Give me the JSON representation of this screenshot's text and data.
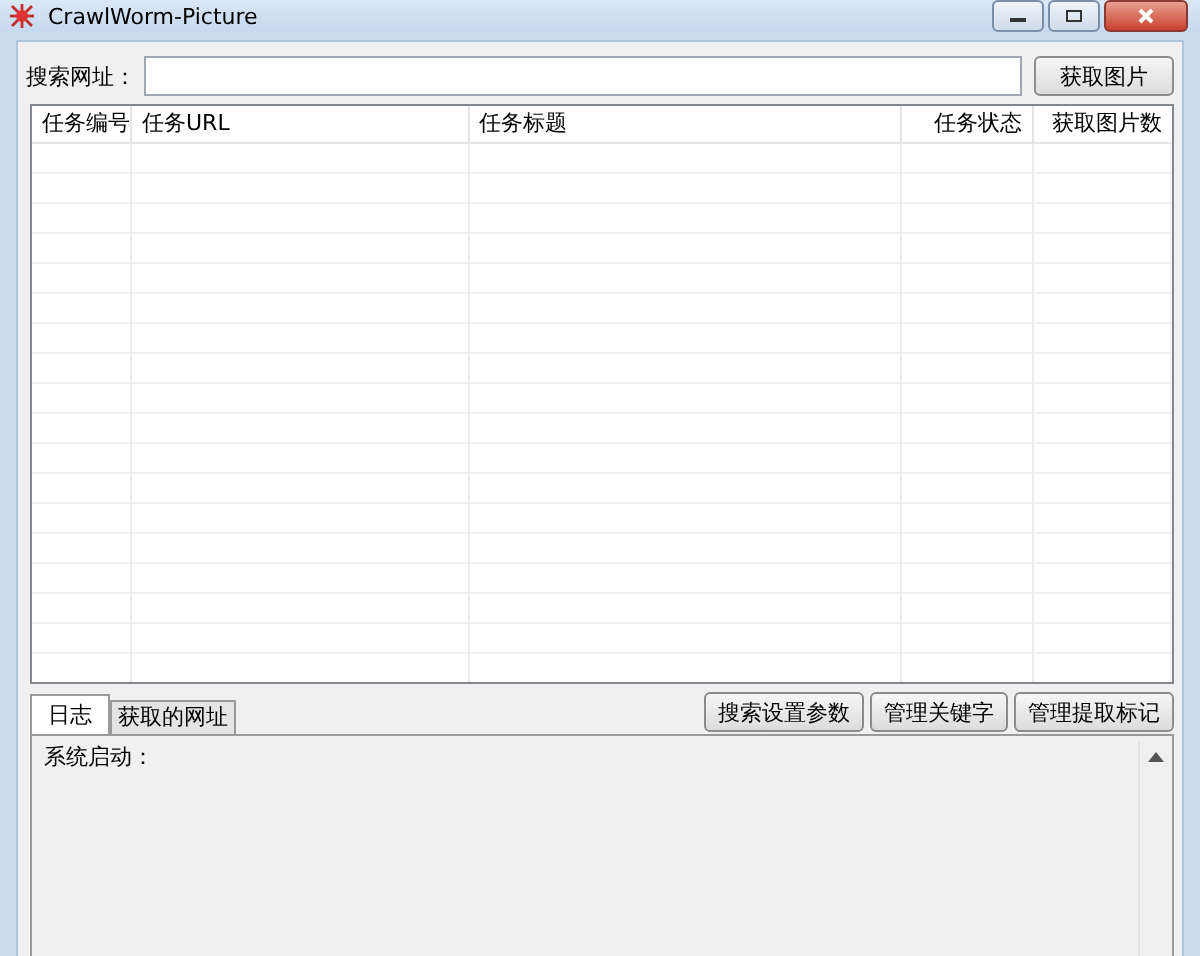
{
  "window": {
    "title": "CrawlWorm-Picture"
  },
  "search": {
    "label": "搜索网址：",
    "button": "获取图片"
  },
  "table": {
    "columns": [
      "任务编号",
      "任务URL",
      "任务标题",
      "任务状态",
      "获取图片数"
    ]
  },
  "tabs": [
    {
      "label": "日志",
      "selected": true
    },
    {
      "label": "获取的网址",
      "selected": false
    }
  ],
  "buttons": [
    "搜索设置参数",
    "管理关键字",
    "管理提取标记"
  ],
  "log": {
    "text": "系统启动："
  }
}
